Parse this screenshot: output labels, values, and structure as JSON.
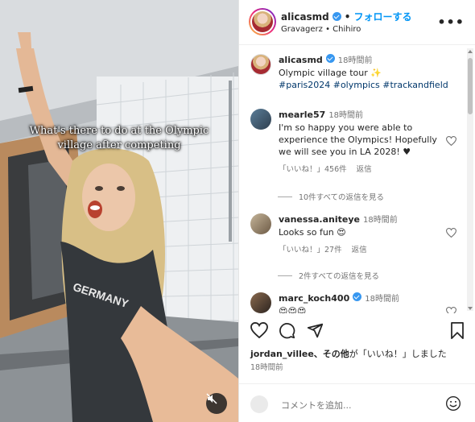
{
  "media": {
    "caption_line1": "What's there to do at the Olympic",
    "caption_line2": "village after competing",
    "shirt_text": "GERMANY"
  },
  "header": {
    "username": "alicasmd",
    "separator": "•",
    "follow_label": "フォローする",
    "subtitle": "Gravagerz • Chihiro",
    "more_label": "•••"
  },
  "post": {
    "username": "alicasmd",
    "time": "18時間前",
    "text": "Olympic village tour ✨",
    "tags": "#paris2024 #olympics #trackandfield"
  },
  "comments": [
    {
      "username": "mearle57",
      "time": "18時間前",
      "text": "I'm so happy you were able to experience the Olympics! Hopefully we will see you in LA 2028! ♥",
      "likes": "「いいね！」456件",
      "reply_label": "返信",
      "view_replies": "10件すべての返信を見る"
    },
    {
      "username": "vanessa.aniteye",
      "time": "18時間前",
      "text": "Looks so fun 😍",
      "likes": "「いいね！」27件",
      "reply_label": "返信",
      "view_replies": "2件すべての返信を見る"
    },
    {
      "username": "marc_koch400",
      "time": "18時間前",
      "text": "😍😍😍"
    }
  ],
  "footer": {
    "liked_by_user": "jordan_villee",
    "liked_by_rest": "、その他",
    "liked_by_suffix": "が「いいね！」しました",
    "time": "18時間前",
    "comment_placeholder": "コメントを追加..."
  },
  "icons": {
    "like": "heart-icon",
    "comment": "comment-icon",
    "share": "share-icon",
    "save": "bookmark-icon",
    "mute": "muted-speaker-icon",
    "emoji": "emoji-icon"
  }
}
